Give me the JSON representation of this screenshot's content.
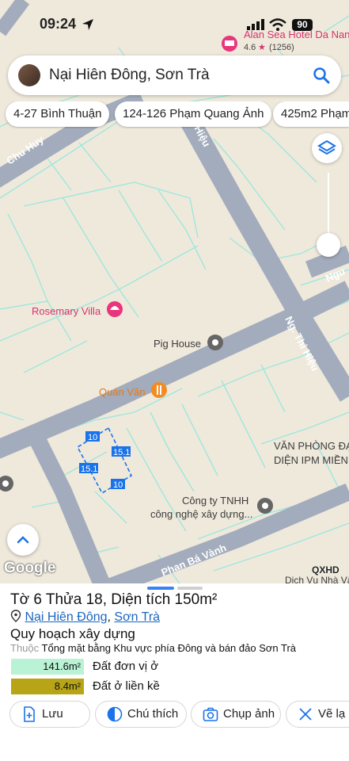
{
  "status": {
    "time": "09:24",
    "battery": "90"
  },
  "search": {
    "query": "Nại Hiên Đông, Sơn Trà"
  },
  "chips": [
    "4-27 Bình Thuận",
    "124-126 Phạm Quang Ảnh",
    "425m2 Phạm"
  ],
  "map": {
    "hotel_name": "Alan Sea Hotel Da Nang",
    "hotel_rating": "4.6",
    "hotel_reviews": "(1256)",
    "places": {
      "rosemary": "Rosemary Villa",
      "pig_house": "Pig House",
      "quan_van": "Quán Văn",
      "office_line1": "VĂN PHÒNG ĐẠ",
      "office_line2": "DIỆN IPM MIỀN",
      "company_line1": "Công ty TNHH",
      "company_line2": "công nghệ xây dựng...",
      "dich_vu": "Dịch Vụ Nhà Và"
    },
    "streets": {
      "chu_huy": "Chu Huy",
      "thi_hieu_top": "hi Hiệu",
      "thi_hieu": "Ng. Thi Hiệu",
      "ngu": "Ngu",
      "phan_ba_vanh": "Phan Bá Vành"
    },
    "parcel_dims": [
      "10",
      "15.1",
      "15.1",
      "10"
    ],
    "google": "Google",
    "qxhd": "QXHD"
  },
  "sheet": {
    "title": "Tờ 6 Thửa 18, Diện tích 150m²",
    "ward": "Nại Hiên Đông",
    "sep": ",",
    "district": "Sơn Trà",
    "planning": "Quy hoạch xây dựng",
    "belong_prefix": "Thuộc",
    "belong_text": "Tổng mặt bằng Khu vực phía Đông và bán đảo Sơn Trà",
    "legend": [
      {
        "value": "141.6m²",
        "label": "Đất đơn vị ở",
        "color": "#b9f2d4"
      },
      {
        "value": "8.4m²",
        "label": "Đất ở liền kề",
        "color": "#b8a417"
      }
    ],
    "actions": [
      "Lưu",
      "Chú thích",
      "Chụp ảnh",
      "Vẽ lạ"
    ]
  }
}
